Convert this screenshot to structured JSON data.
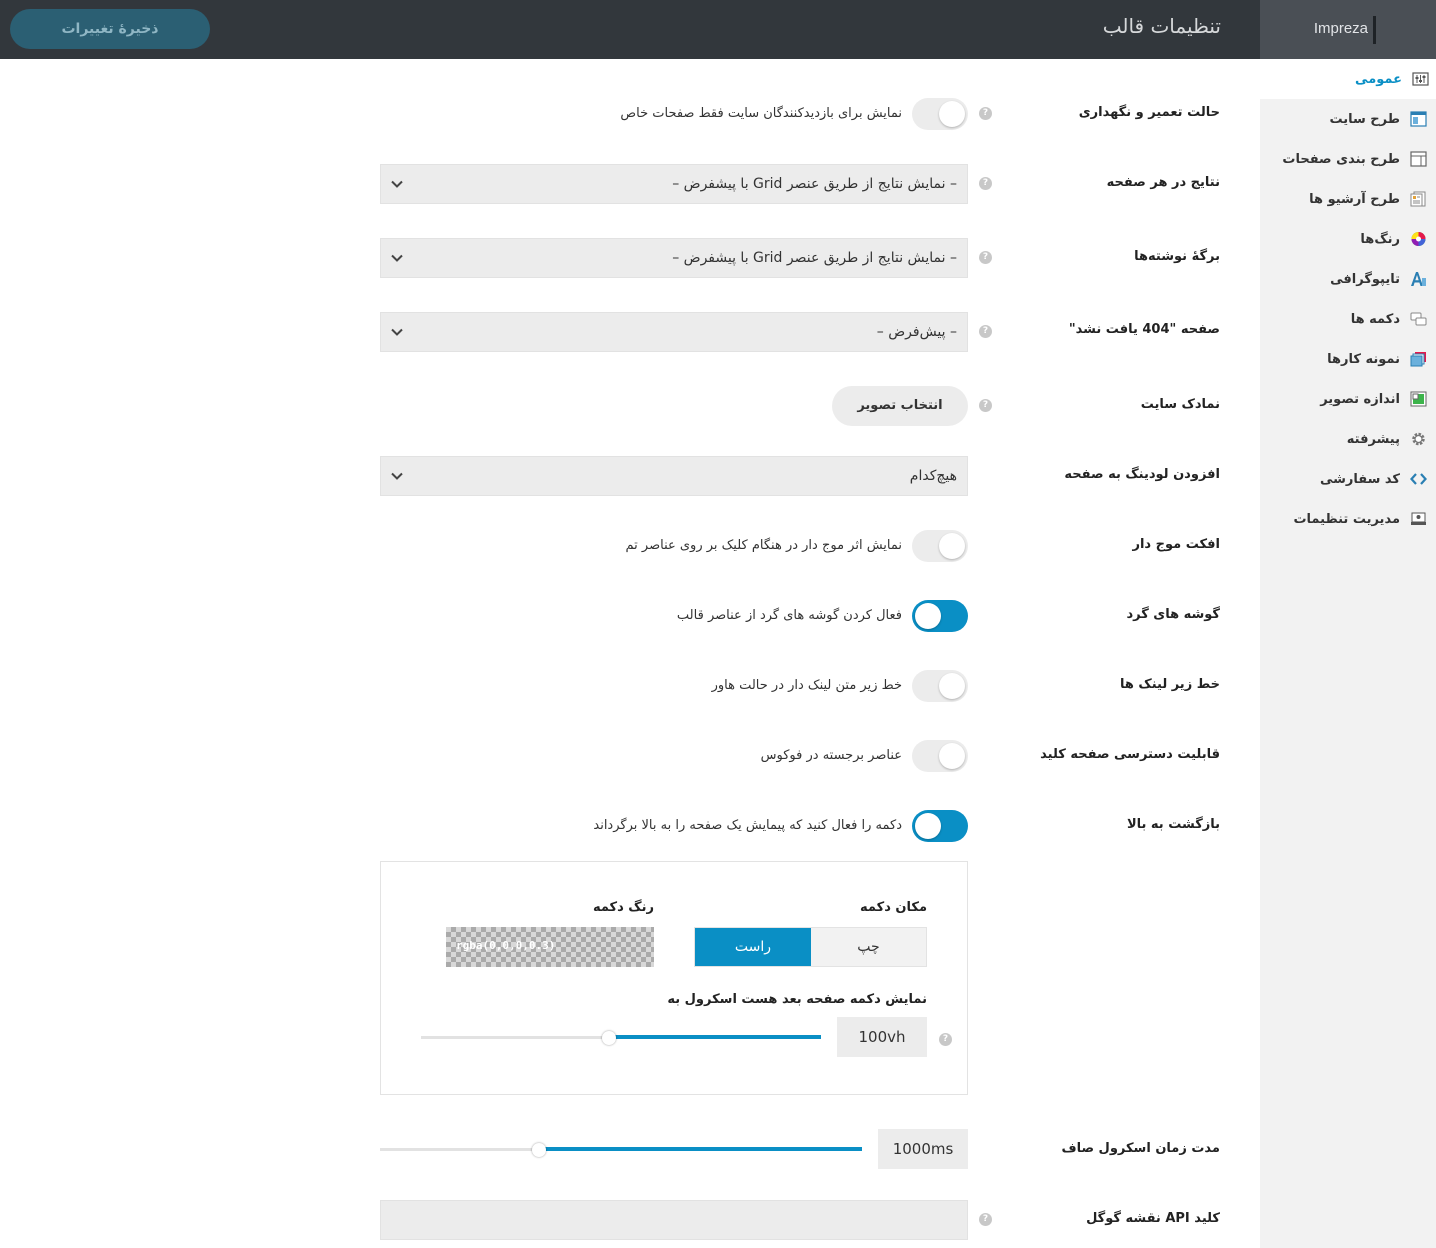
{
  "app": {
    "brand": "Impreza",
    "title": "تنظیمات قالب",
    "save_label": "ذخیرهٔ تغییرات"
  },
  "colors": {
    "accent": "#0a8fc5",
    "topbar": "#32373c",
    "sidebar_bg": "#f2f2f2"
  },
  "sidebar": {
    "items": [
      {
        "label": "عمومی",
        "icon": "sliders-icon",
        "active": true
      },
      {
        "label": "طرح سایت",
        "icon": "layout-icon"
      },
      {
        "label": "طرح بندی صفحات",
        "icon": "page-layout-icon"
      },
      {
        "label": "طرح آرشیو ها",
        "icon": "archive-icon"
      },
      {
        "label": "رنگ‌ها",
        "icon": "color-wheel-icon"
      },
      {
        "label": "تایپوگرافی",
        "icon": "typography-icon"
      },
      {
        "label": "دکمه ها",
        "icon": "buttons-icon"
      },
      {
        "label": "نمونه کارها",
        "icon": "portfolio-icon"
      },
      {
        "label": "اندازه تصویر",
        "icon": "image-size-icon"
      },
      {
        "label": "پیشرفته",
        "icon": "gear-icon"
      },
      {
        "label": "کد سفارشی",
        "icon": "code-icon"
      },
      {
        "label": "مدیریت تنظیمات",
        "icon": "manage-icon"
      }
    ]
  },
  "settings": {
    "maintenance": {
      "label": "حالت تعمیر و نگهداری",
      "text": "نمایش برای بازدیدکنندگان سایت فقط صفحات خاص",
      "on": false
    },
    "results_per_page": {
      "label": "نتایج در هر صفحه",
      "value": "– نمایش نتایج از طریق عنصر Grid با پیشفرض –"
    },
    "posts_page": {
      "label": "برگهٔ نوشته‌ها",
      "value": "– نمایش نتایج از طریق عنصر Grid با پیشفرض –"
    },
    "page_404": {
      "label": "صفحه \"404 یافت نشد\"",
      "value": "– پیش‌فرض –"
    },
    "site_icon": {
      "label": "نمادک سایت",
      "button": "انتخاب تصویر"
    },
    "page_loader": {
      "label": "افزودن لودینگ به صفحه",
      "value": "هیچ‌کدام"
    },
    "ripple": {
      "label": "افکت موج دار",
      "text": "نمایش اثر موج دار در هنگام کلیک بر روی عناصر تم",
      "on": false
    },
    "rounded": {
      "label": "گوشه های گرد",
      "text": "فعال کردن گوشه های گرد از عناصر قالب",
      "on": true
    },
    "link_underline": {
      "label": "خط زیر لینک ها",
      "text": "خط زیر متن لینک دار در حالت هاور",
      "on": false
    },
    "keyboard": {
      "label": "قابلیت دسترسی صفحه کلید",
      "text": "عناصر برجسته در فوکوس",
      "on": false
    },
    "back_to_top": {
      "label": "بازگشت به بالا",
      "text": "دکمه را فعال کنید که پیمایش یک صفحه را به بالا برگرداند",
      "on": true,
      "position_label": "مکان دکمه",
      "position_options": [
        "راست",
        "چپ"
      ],
      "position_selected": "راست",
      "color_label": "رنگ دکمه",
      "color_value": "rgba(0,0,0,0.3)",
      "show_after_label": "نمایش دکمه صفحه بعد هست اسکرول به",
      "show_after_value": "100vh",
      "show_after_fraction": 0.47
    },
    "smooth_scroll": {
      "label": "مدت زمان اسکرول صاف",
      "value": "1000ms",
      "fraction": 0.33
    },
    "gmaps_api": {
      "label": "کلید API نقشه گوگل",
      "value": ""
    }
  }
}
